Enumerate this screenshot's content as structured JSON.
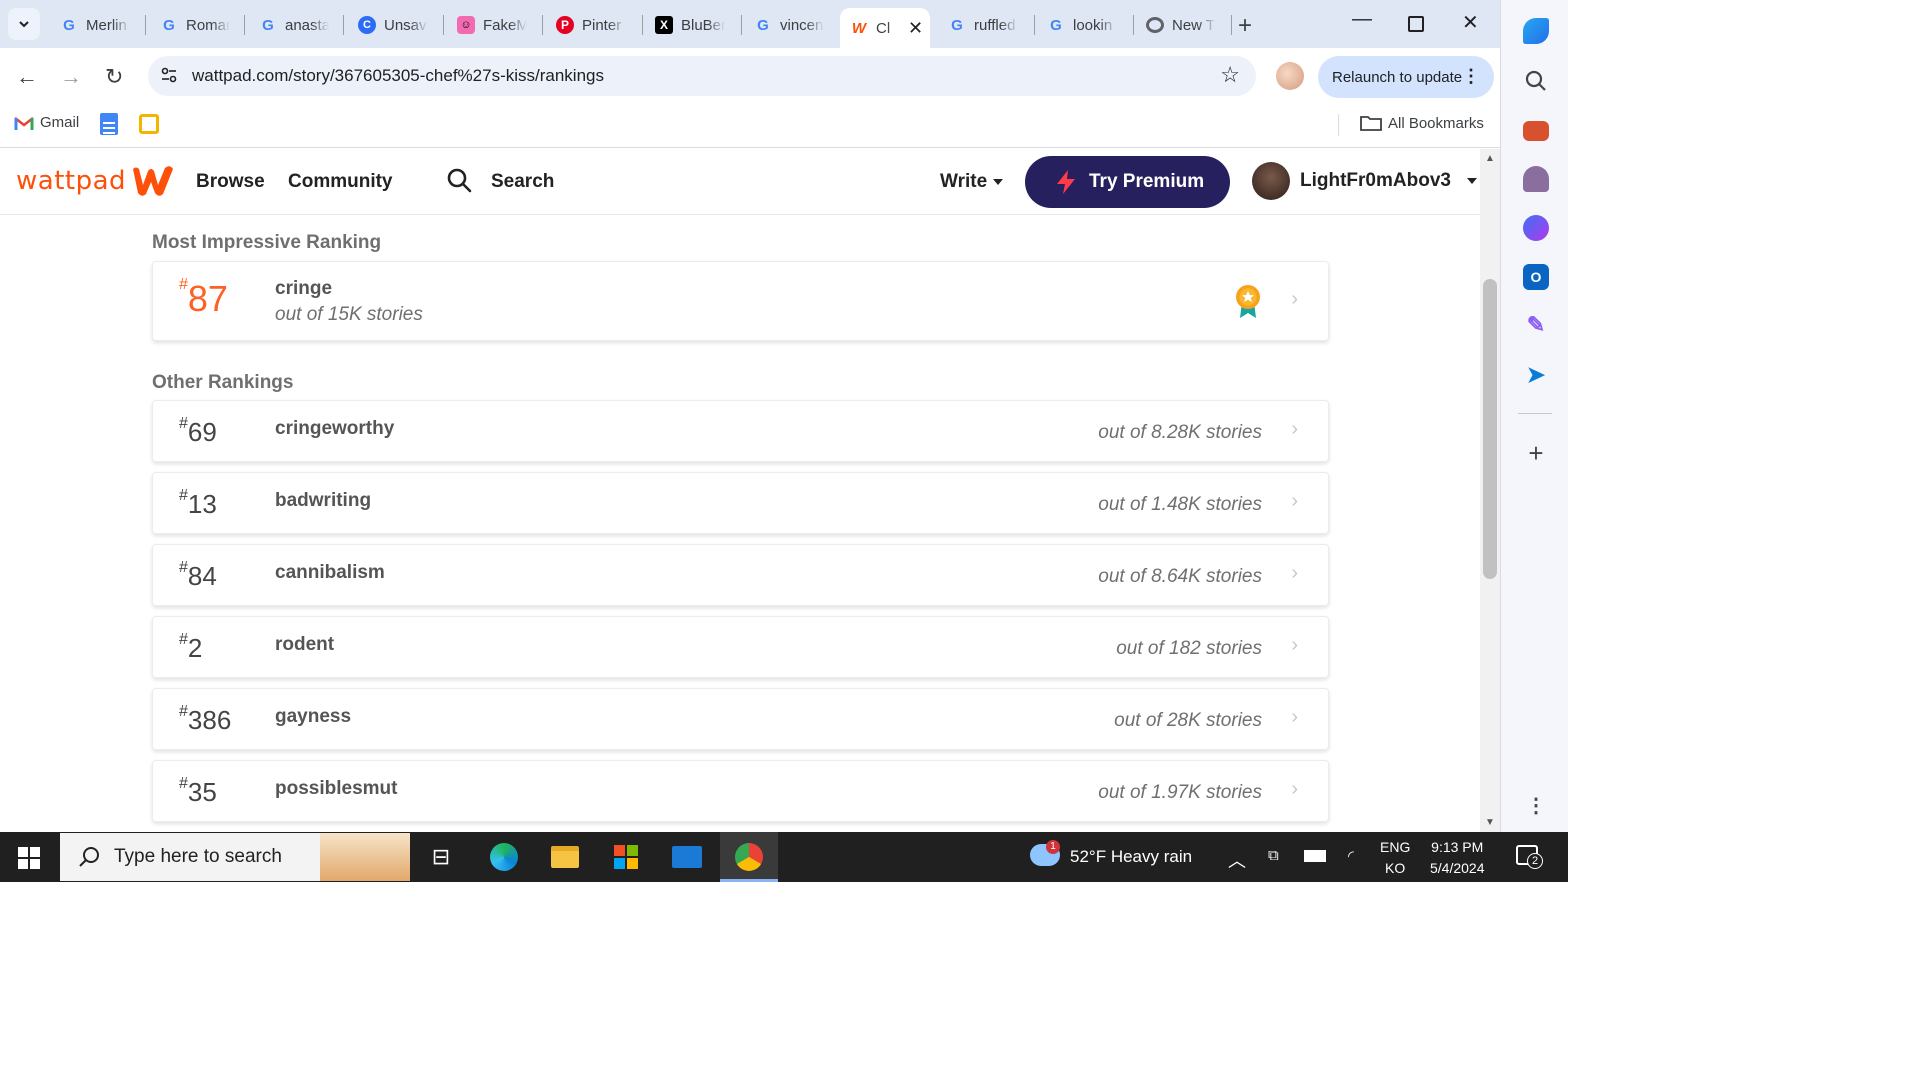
{
  "browser": {
    "tabs": [
      {
        "title": "Merlin",
        "favicon": "google-g"
      },
      {
        "title": "Romar",
        "favicon": "google-g"
      },
      {
        "title": "anasta",
        "favicon": "google-g"
      },
      {
        "title": "Unsav",
        "favicon": "unsave-icon"
      },
      {
        "title": "FakeM",
        "favicon": "fakem-icon"
      },
      {
        "title": "Pinter",
        "favicon": "pinterest-icon"
      },
      {
        "title": "BluBer",
        "favicon": "x-icon"
      },
      {
        "title": "vincen",
        "favicon": "google-g"
      },
      {
        "title": "Cl",
        "favicon": "wattpad-w",
        "active": true
      },
      {
        "title": "ruffled",
        "favicon": "google-g"
      },
      {
        "title": "lookin",
        "favicon": "google-g"
      },
      {
        "title": "New T",
        "favicon": "chrome-icon"
      }
    ],
    "url": "wattpad.com/story/367605305-chef%27s-kiss/rankings",
    "relaunch_label": "Relaunch to update",
    "bookmarks": {
      "gmail": "Gmail",
      "all": "All Bookmarks"
    }
  },
  "header": {
    "logo_text": "wattpad",
    "nav": {
      "browse": "Browse",
      "community": "Community",
      "search": "Search"
    },
    "write": "Write",
    "premium": "Try Premium",
    "username": "LightFr0mAbov3"
  },
  "rankings": {
    "top_title": "Most Impressive Ranking",
    "top": {
      "hash": "#",
      "rank": "87",
      "tag": "cringe",
      "out_of": "out of 15K stories"
    },
    "other_title": "Other Rankings",
    "others": [
      {
        "hash": "#",
        "rank": "69",
        "tag": "cringeworthy",
        "out_of": "out of 8.28K stories"
      },
      {
        "hash": "#",
        "rank": "13",
        "tag": "badwriting",
        "out_of": "out of 1.48K stories"
      },
      {
        "hash": "#",
        "rank": "84",
        "tag": "cannibalism",
        "out_of": "out of 8.64K stories"
      },
      {
        "hash": "#",
        "rank": "2",
        "tag": "rodent",
        "out_of": "out of 182 stories"
      },
      {
        "hash": "#",
        "rank": "386",
        "tag": "gayness",
        "out_of": "out of 28K stories"
      },
      {
        "hash": "#",
        "rank": "35",
        "tag": "possiblesmut",
        "out_of": "out of 1.97K stories"
      }
    ]
  },
  "taskbar": {
    "search_placeholder": "Type here to search",
    "weather_badge": "1",
    "weather": "52°F  Heavy rain",
    "lang_top": "ENG",
    "lang_bottom": "KO",
    "time": "9:13 PM",
    "date": "5/4/2024",
    "notifications": "2"
  },
  "colors": {
    "wattpad_orange": "#ff500a",
    "premium_navy": "#26215e",
    "rank_orange": "#ff6122"
  }
}
